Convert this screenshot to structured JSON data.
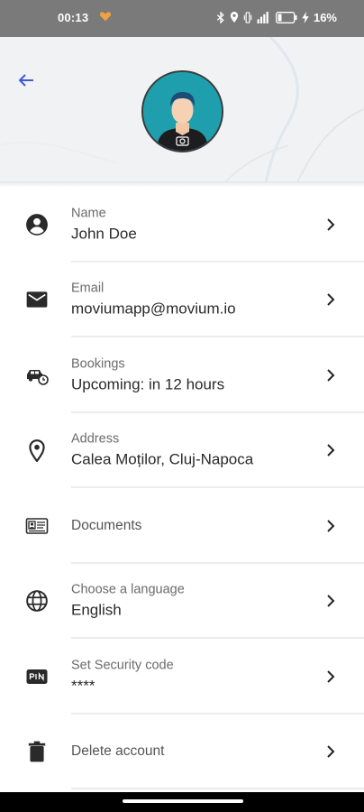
{
  "status_bar": {
    "time": "00:13",
    "battery": "16%",
    "icons": [
      "heart-app-icon",
      "bluetooth-icon",
      "location-icon",
      "vibrate-icon",
      "signal-icon",
      "battery-icon",
      "charging-icon"
    ]
  },
  "header": {
    "back_icon": "arrow-left-icon",
    "avatar_icon": "profile-avatar-camera-icon"
  },
  "profile": {
    "items": [
      {
        "icon": "account-circle-icon",
        "label": "Name",
        "value": "John Doe"
      },
      {
        "icon": "envelope-icon",
        "label": "Email",
        "value": "moviumapp@movium.io"
      },
      {
        "icon": "car-clock-icon",
        "label": "Bookings",
        "value": "Upcoming: in 12 hours"
      },
      {
        "icon": "location-pin-icon",
        "label": "Address",
        "value": "Calea Moților, Cluj-Napoca"
      },
      {
        "icon": "id-card-icon",
        "label": "Documents",
        "value": ""
      },
      {
        "icon": "globe-icon",
        "label": "Choose a language",
        "value": "English"
      },
      {
        "icon": "pin-keypad-icon",
        "label": "Set Security code",
        "value": "****"
      },
      {
        "icon": "trash-icon",
        "label": "Delete account",
        "value": ""
      }
    ]
  },
  "colors": {
    "accent": "#3b5bdb",
    "avatar_bg": "#1f9fae",
    "status_bar": "#7a7a7a",
    "header_bg": "#f1f2f3"
  }
}
